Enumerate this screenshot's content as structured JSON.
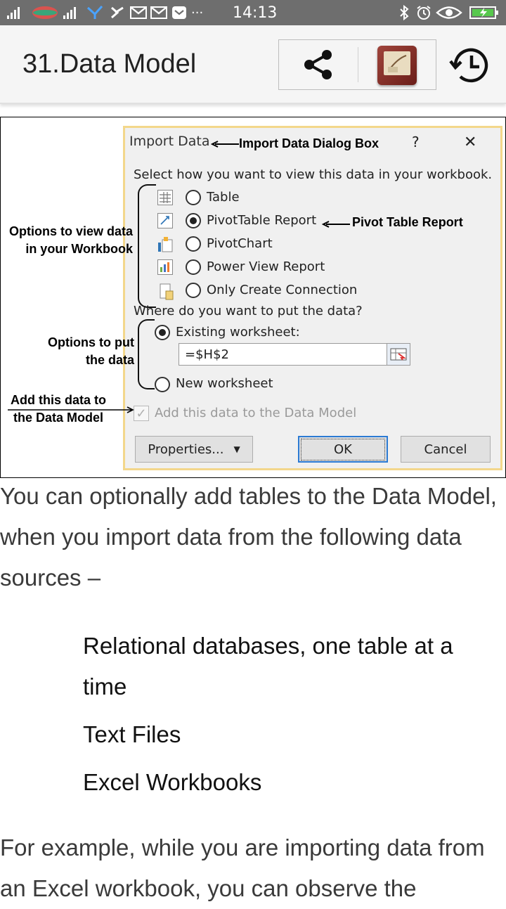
{
  "status_bar": {
    "time": "14:13",
    "icons": [
      "signal-icon",
      "carrier-logo-icon",
      "signal-icon",
      "tethering-icon",
      "check-icon",
      "gmail-icon",
      "gmail-icon",
      "mail-icon",
      "more-icon",
      "bluetooth-icon",
      "alarm-icon",
      "eye-icon",
      "battery-charging-icon"
    ],
    "more": "···",
    "background": "#6e6e6e"
  },
  "app_bar": {
    "title": "31.Data Model",
    "actions": [
      "share-icon",
      "book-icon",
      "history-icon"
    ]
  },
  "figure": {
    "dialog": {
      "title": "Import Data",
      "help": "?",
      "close": "✕",
      "section1": "Select how you want to view this data in your workbook.",
      "view_options": [
        {
          "label": "Table",
          "selected": false,
          "icon": "table-icon"
        },
        {
          "label": "PivotTable Report",
          "selected": true,
          "icon": "pivottable-icon"
        },
        {
          "label": "PivotChart",
          "selected": false,
          "icon": "pivotchart-icon"
        },
        {
          "label": "Power View Report",
          "selected": false,
          "icon": "power-view-icon"
        },
        {
          "label": "Only Create Connection",
          "selected": false,
          "icon": "connection-icon"
        }
      ],
      "section2": "Where do you want to put the data?",
      "existing_worksheet": "Existing worksheet:",
      "cell_reference": "=$H$2",
      "new_worksheet": "New worksheet",
      "add_to_model": "Add this data to the Data Model",
      "properties_button": "Properties...",
      "ok_button": "OK",
      "cancel_button": "Cancel"
    },
    "annotations": {
      "dialog_box": "Import Data Dialog Box",
      "pivot_table": "Pivot Table Report",
      "view_options_line1": "Options to view data",
      "view_options_line2": "in your Workbook",
      "put_data_line1": "Options to put",
      "put_data_line2": "the  data",
      "add_model_line1": "Add this data to",
      "add_model_line2": "the Data Model"
    }
  },
  "article": {
    "intro": "You can optionally add tables to the Data Model, when you import data from the following data sources –",
    "sources": [
      "Relational databases, one table at a time",
      "Text Files",
      "Excel Workbooks"
    ],
    "followup": "For example, while you are importing data from an Excel workbook, you can observe the"
  }
}
